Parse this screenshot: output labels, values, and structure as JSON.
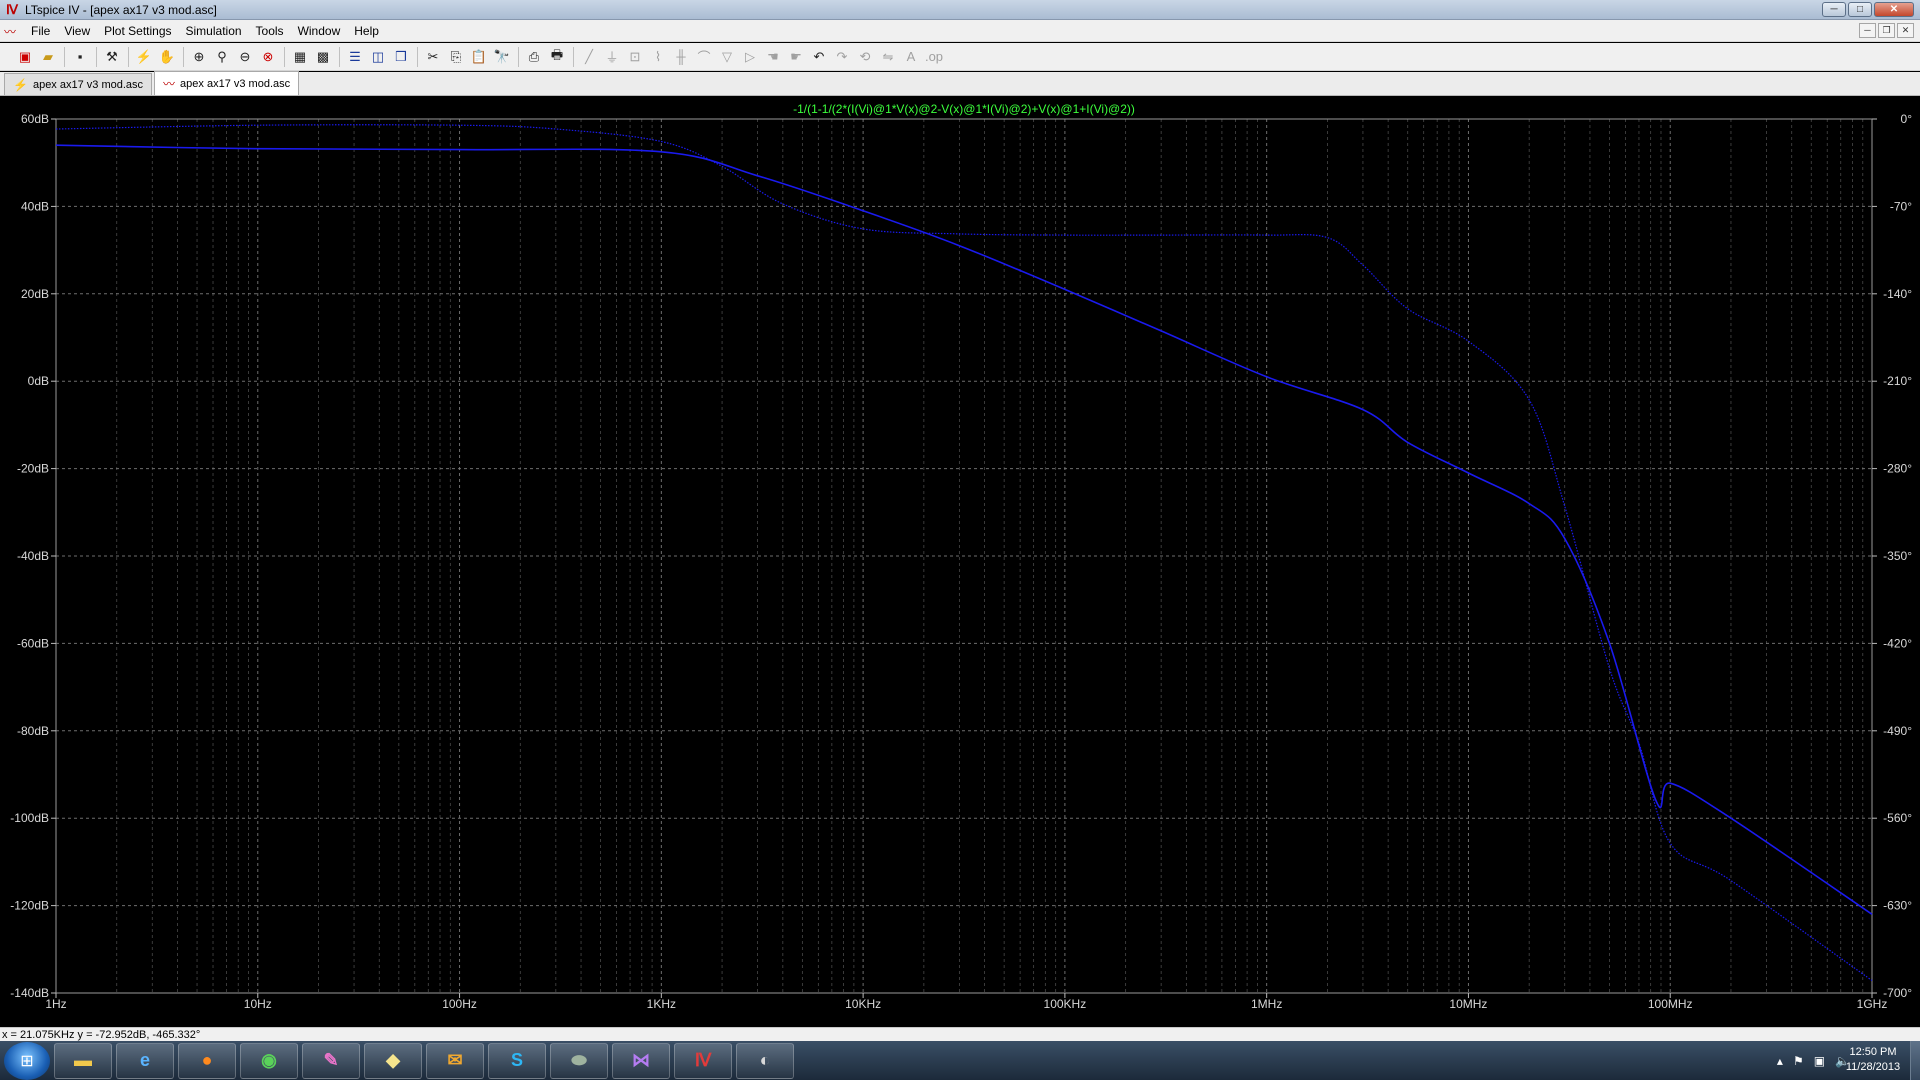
{
  "window": {
    "title": "LTspice IV - [apex ax17 v3 mod.asc]"
  },
  "menu": [
    "File",
    "View",
    "Plot Settings",
    "Simulation",
    "Tools",
    "Window",
    "Help"
  ],
  "tabs": [
    {
      "label": "apex ax17 v3 mod.asc",
      "icon": "schematic-icon",
      "active": false
    },
    {
      "label": "apex ax17 v3 mod.asc",
      "icon": "waveform-icon",
      "active": true
    }
  ],
  "status": {
    "cursor_text": "x = 21.075KHz   y = -72.952dB, -465.332°"
  },
  "clock": {
    "time": "12:50 PM",
    "date": "11/28/2013"
  },
  "colors": {
    "trace": "#1a1aee",
    "trace_title": "#3cff3c",
    "grid": "#7a7a7a",
    "axis_text": "#d8d8d8",
    "background": "#000000"
  },
  "chart_data": {
    "type": "line",
    "title": "-1/(1-1/(2*(I(Vi)@1*V(x)@2-V(x)@1*I(Vi)@2)+V(x)@1+I(Vi)@2))",
    "xlabel": "",
    "ylabel": "",
    "x_scale": "log",
    "xlim_hz": [
      1,
      1000000000
    ],
    "ylim_db": [
      -140,
      60
    ],
    "y2lim_deg": [
      -700,
      0
    ],
    "grid": true,
    "x_ticks": [
      {
        "hz": 1,
        "label": "1Hz"
      },
      {
        "hz": 10,
        "label": "10Hz"
      },
      {
        "hz": 100,
        "label": "100Hz"
      },
      {
        "hz": 1000,
        "label": "1KHz"
      },
      {
        "hz": 10000,
        "label": "10KHz"
      },
      {
        "hz": 100000,
        "label": "100KHz"
      },
      {
        "hz": 1000000,
        "label": "1MHz"
      },
      {
        "hz": 10000000,
        "label": "10MHz"
      },
      {
        "hz": 100000000,
        "label": "100MHz"
      },
      {
        "hz": 1000000000,
        "label": "1GHz"
      }
    ],
    "y_ticks": [
      {
        "db": 60,
        "label": "60dB"
      },
      {
        "db": 40,
        "label": "40dB"
      },
      {
        "db": 20,
        "label": "20dB"
      },
      {
        "db": 0,
        "label": "0dB"
      },
      {
        "db": -20,
        "label": "-20dB"
      },
      {
        "db": -40,
        "label": "-40dB"
      },
      {
        "db": -60,
        "label": "-60dB"
      },
      {
        "db": -80,
        "label": "-80dB"
      },
      {
        "db": -100,
        "label": "-100dB"
      },
      {
        "db": -120,
        "label": "-120dB"
      },
      {
        "db": -140,
        "label": "-140dB"
      }
    ],
    "y2_ticks": [
      {
        "deg": 0,
        "label": "0°"
      },
      {
        "deg": -70,
        "label": "-70°"
      },
      {
        "deg": -140,
        "label": "-140°"
      },
      {
        "deg": -210,
        "label": "-210°"
      },
      {
        "deg": -280,
        "label": "-280°"
      },
      {
        "deg": -350,
        "label": "-350°"
      },
      {
        "deg": -420,
        "label": "-420°"
      },
      {
        "deg": -490,
        "label": "-490°"
      },
      {
        "deg": -560,
        "label": "-560°"
      },
      {
        "deg": -630,
        "label": "-630°"
      },
      {
        "deg": -700,
        "label": "-700°"
      }
    ],
    "series": [
      {
        "quantity": "magnitude",
        "style": "solid",
        "axis": "left",
        "points": [
          [
            1,
            54
          ],
          [
            10,
            53.2
          ],
          [
            100,
            53
          ],
          [
            1000,
            52.5
          ],
          [
            3000,
            47
          ],
          [
            10000,
            39
          ],
          [
            30000,
            31
          ],
          [
            100000,
            21
          ],
          [
            300000,
            11.5
          ],
          [
            1000000,
            1
          ],
          [
            3000000,
            -6.5
          ],
          [
            5000000,
            -14
          ],
          [
            10000000,
            -21
          ],
          [
            20000000,
            -28
          ],
          [
            30000000,
            -36
          ],
          [
            50000000,
            -60
          ],
          [
            85000000,
            -96
          ],
          [
            100000000,
            -92
          ],
          [
            200000000,
            -100
          ],
          [
            1000000000,
            -122
          ]
        ]
      },
      {
        "quantity": "phase",
        "style": "dotted",
        "axis": "right",
        "points": [
          [
            1,
            -8
          ],
          [
            10,
            -5
          ],
          [
            100,
            -5
          ],
          [
            300,
            -8
          ],
          [
            1000,
            -18
          ],
          [
            2000,
            -38
          ],
          [
            4000,
            -68
          ],
          [
            10000,
            -88
          ],
          [
            30000,
            -92
          ],
          [
            100000,
            -93
          ],
          [
            300000,
            -93
          ],
          [
            1000000,
            -93
          ],
          [
            2000000,
            -95
          ],
          [
            3000000,
            -117
          ],
          [
            5000000,
            -152
          ],
          [
            10000000,
            -178
          ],
          [
            20000000,
            -225
          ],
          [
            30000000,
            -310
          ],
          [
            50000000,
            -440
          ],
          [
            70000000,
            -500
          ],
          [
            100000000,
            -580
          ],
          [
            200000000,
            -610
          ],
          [
            1000000000,
            -690
          ]
        ]
      }
    ]
  }
}
